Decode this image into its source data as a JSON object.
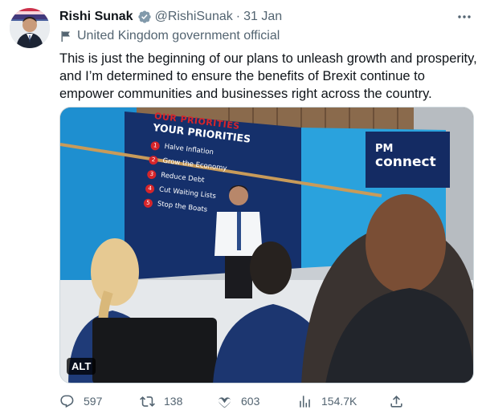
{
  "tweet": {
    "author_name": "Rishi Sunak",
    "handle": "@RishiSunak",
    "separator": "·",
    "date": "31 Jan",
    "affiliation": "United Kingdom government official",
    "text": "This is just the beginning of our plans to unleash growth and prosperity, and I’m determined to ensure the benefits of Brexit continue to empower communities and businesses right across the country."
  },
  "media": {
    "alt_label": "ALT",
    "banner_heading_1": "OUR PRIORITIES",
    "banner_heading_2": "YOUR PRIORITIES",
    "priorities": [
      {
        "num": "1",
        "label": "Halve Inflation"
      },
      {
        "num": "2",
        "label": "Grow the Economy"
      },
      {
        "num": "3",
        "label": "Reduce Debt"
      },
      {
        "num": "4",
        "label": "Cut Waiting Lists"
      },
      {
        "num": "5",
        "label": "Stop the Boats"
      }
    ],
    "logo_line_1": "PM",
    "logo_line_2": "connect"
  },
  "actions": {
    "replies": "597",
    "retweets": "138",
    "likes": "603",
    "views": "154.7K"
  },
  "colors": {
    "text_primary": "#0f1419",
    "text_secondary": "#536471",
    "verified": "#829aab",
    "banner_navy": "#15306b",
    "banner_red": "#d6252a"
  },
  "icons": {
    "verified": "verified-badge-icon",
    "affiliation": "flag-icon",
    "more": "more-icon",
    "reply": "reply-icon",
    "retweet": "retweet-icon",
    "like": "heart-icon",
    "views": "views-icon",
    "share": "share-icon"
  }
}
